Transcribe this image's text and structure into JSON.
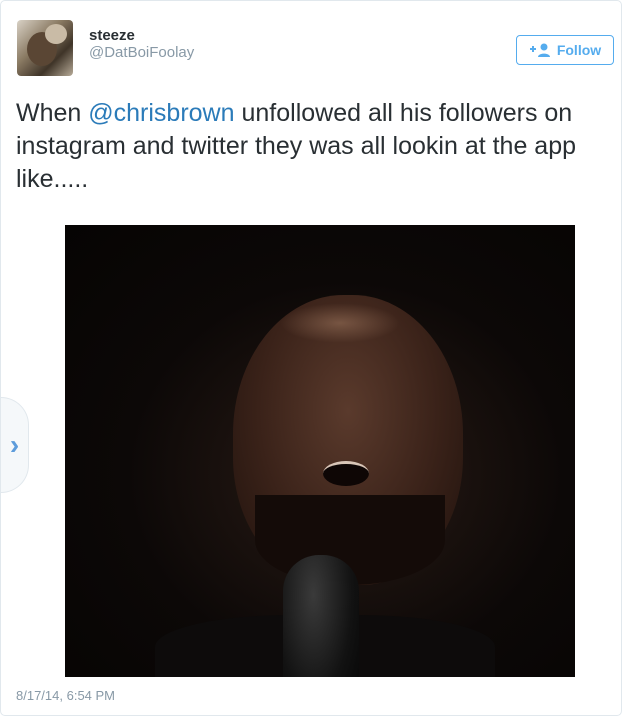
{
  "tweet": {
    "author": {
      "display_name": "steeze",
      "handle": "@DatBoiFoolay"
    },
    "follow_button": {
      "label": "Follow"
    },
    "text": {
      "prefix": "When ",
      "mention": "@chrisbrown",
      "suffix": " unfollowed all his followers on instagram and twitter they was all lookin at the app like....."
    },
    "media_nav": {
      "arrow": "›"
    },
    "timestamp": "8/17/14, 6:54 PM"
  },
  "colors": {
    "accent": "#55acee",
    "mention": "#2b7bb9",
    "muted": "#8899a6",
    "text": "#292f33"
  },
  "icons": {
    "follow": "add-user-icon",
    "nav": "chevron-right-icon"
  }
}
